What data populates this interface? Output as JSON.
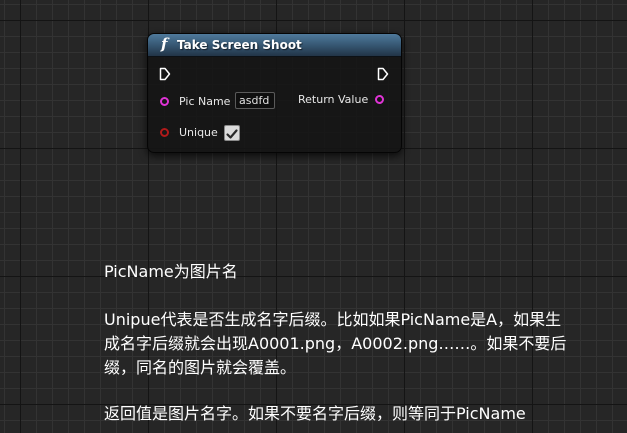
{
  "node": {
    "title": "Take Screen Shoot",
    "header_color": "#3f6584",
    "icon": "function-icon",
    "pins": {
      "exec_in": "exec-in-pin-icon",
      "exec_out": "exec-out-pin-icon",
      "pic_name": {
        "label": "Pic Name",
        "value": "asdfd",
        "pin_color": "#e033d6"
      },
      "return_value": {
        "label": "Return Value",
        "pin_color": "#e033d6"
      },
      "unique": {
        "label": "Unique",
        "checked": true,
        "pin_color": "#b01a1a"
      }
    }
  },
  "caption": {
    "line1": "PicName为图片名",
    "line2": "Unipue代表是否生成名字后缀。比如如果PicName是A，如果生",
    "line3": "成名字后缀就会出现A0001.png，A0002.png……。如果不要后",
    "line4": "缀，同名的图片就会覆盖。",
    "line5": "返回值是图片名字。如果不要名字后缀，则等同于PicName"
  }
}
